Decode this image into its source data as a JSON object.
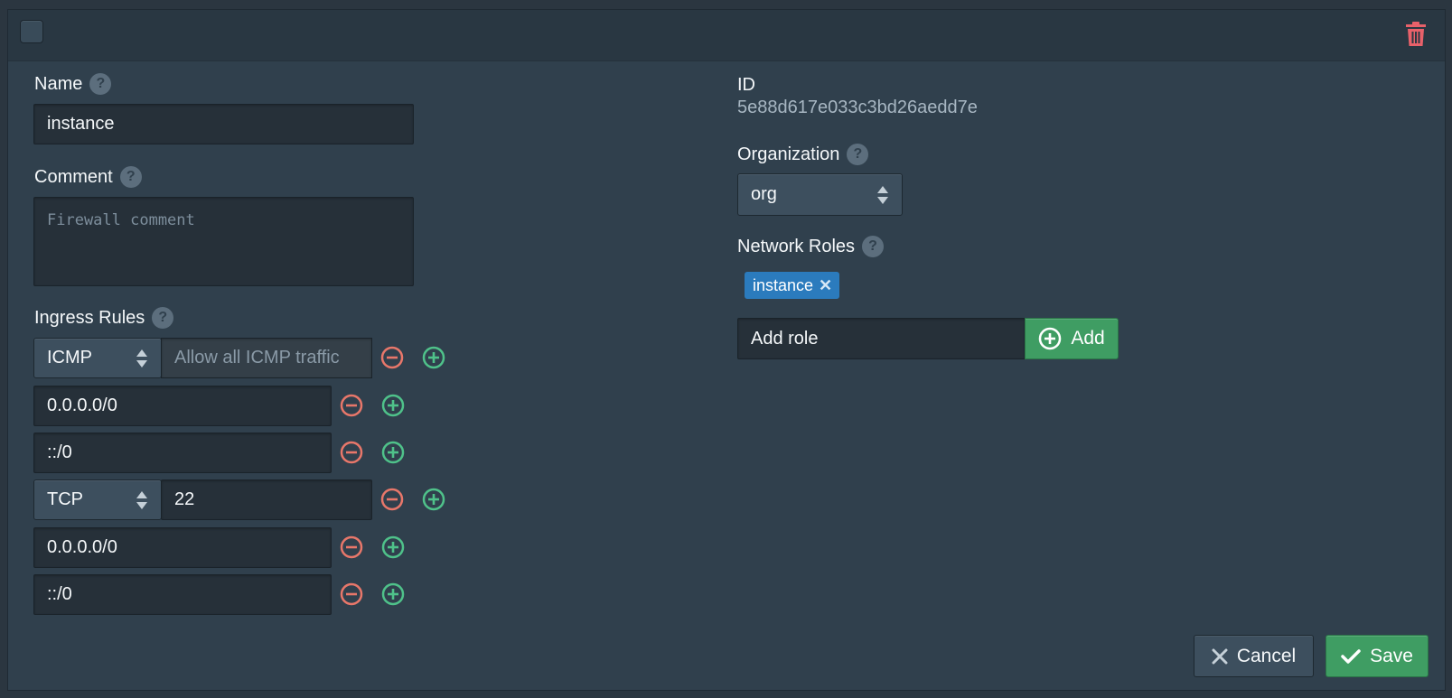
{
  "header": {
    "checkbox_icon": "checkbox",
    "delete_icon": "trash-icon"
  },
  "name": {
    "label": "Name",
    "value": "instance"
  },
  "comment": {
    "label": "Comment",
    "placeholder": "Firewall comment"
  },
  "ingress": {
    "label": "Ingress Rules",
    "rules": [
      {
        "protocol": "ICMP",
        "port": "",
        "port_placeholder": "Allow all ICMP traffic",
        "sources": [
          "0.0.0.0/0",
          "::/0"
        ]
      },
      {
        "protocol": "TCP",
        "port": "22",
        "port_placeholder": "",
        "sources": [
          "0.0.0.0/0",
          "::/0"
        ]
      }
    ]
  },
  "id": {
    "label": "ID",
    "value": "5e88d617e033c3bd26aedd7e"
  },
  "organization": {
    "label": "Organization",
    "value": "org"
  },
  "network_roles": {
    "label": "Network Roles",
    "tags": [
      "instance"
    ],
    "add_placeholder": "Add role",
    "add_label": "Add"
  },
  "actions": {
    "cancel_label": "Cancel",
    "save_label": "Save"
  },
  "colors": {
    "remove": "#e8776a",
    "add": "#4fc28a",
    "delete": "#e8616a",
    "primary": "#3f9d63",
    "tag": "#2b7bbd"
  }
}
